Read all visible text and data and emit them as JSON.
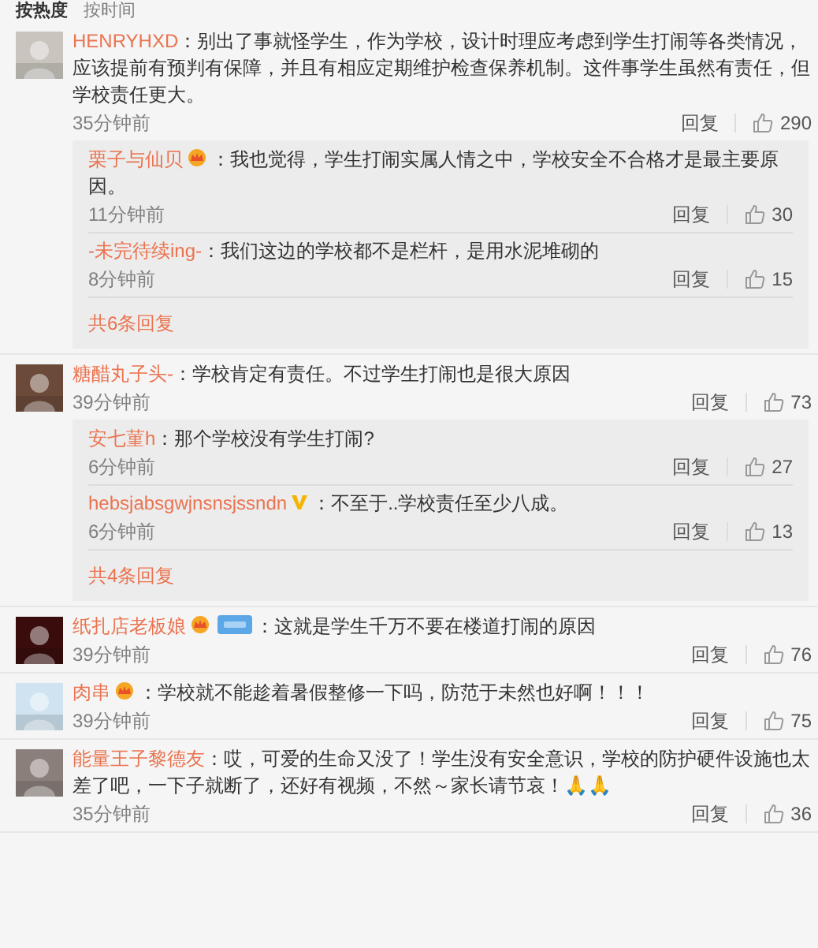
{
  "sort_tabs": [
    {
      "label": "按热度",
      "selected": true
    },
    {
      "label": "按时间",
      "selected": false
    }
  ],
  "comments": [
    {
      "name": "HENRYHXD",
      "text": "：别出了事就怪学生，作为学校，设计时理应考虑到学生打闹等各类情况，应该提前有预判有保障，并且有相应定期维护检查保养机制。这件事学生虽然有责任，但学校责任更大。",
      "time": "35分钟前",
      "reply_label": "回复",
      "likes": "290",
      "replies": [
        {
          "name": "栗子与仙贝",
          "crown": true,
          "text": "：我也觉得，学生打闹实属人情之中，学校安全不合格才是最主要原因。",
          "time": "11分钟前",
          "reply_label": "回复",
          "likes": "30"
        },
        {
          "name": "-未完待续ing-",
          "text": "：我们这边的学校都不是栏杆，是用水泥堆砌的",
          "time": "8分钟前",
          "reply_label": "回复",
          "likes": "15"
        }
      ],
      "more": "共6条回复"
    },
    {
      "name": "糖醋丸子头-",
      "text": "：学校肯定有责任。不过学生打闹也是很大原因",
      "time": "39分钟前",
      "reply_label": "回复",
      "likes": "73",
      "replies": [
        {
          "name": "安七菫h",
          "text": "：那个学校没有学生打闹?",
          "time": "6分钟前",
          "reply_label": "回复",
          "likes": "27"
        },
        {
          "name": "hebsjabsgwjnsnsjssndn",
          "verified": true,
          "text": "：不至于..学校责任至少八成。",
          "time": "6分钟前",
          "reply_label": "回复",
          "likes": "13"
        }
      ],
      "more": "共4条回复"
    },
    {
      "name": "纸扎店老板娘",
      "crown": true,
      "fan_badge": true,
      "text": "：这就是学生千万不要在楼道打闹的原因",
      "time": "39分钟前",
      "reply_label": "回复",
      "likes": "76"
    },
    {
      "name": "肉串",
      "crown": true,
      "text": "：学校就不能趁着暑假整修一下吗，防范于未然也好啊！！！",
      "time": "39分钟前",
      "reply_label": "回复",
      "likes": "75"
    },
    {
      "name": "能量王子黎德友",
      "text": "：哎，可爱的生命又没了！学生没有安全意识，学校的防护硬件设施也太差了吧，一下子就断了，还好有视频，不然～家长请节哀！🙏🙏",
      "time": "35分钟前",
      "reply_label": "回复",
      "likes": "36"
    }
  ]
}
